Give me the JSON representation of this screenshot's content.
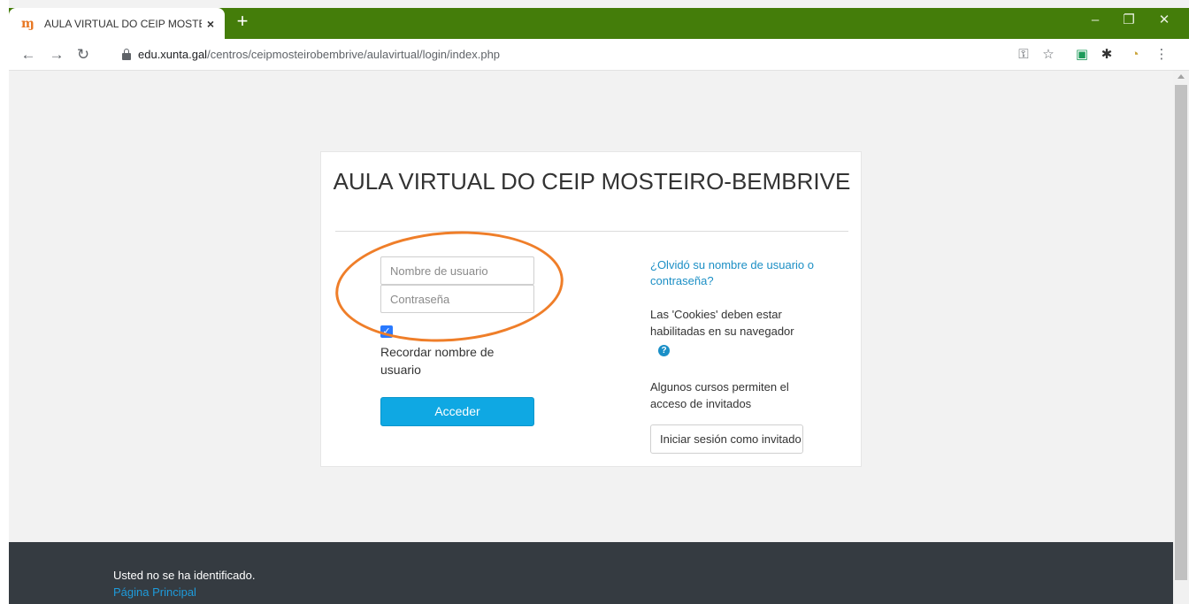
{
  "browser": {
    "tab_title": "AULA VIRTUAL DO CEIP MOSTEIR",
    "tab_close": "×",
    "new_tab": "+",
    "url_host": "edu.xunta.gal",
    "url_path": "/centros/ceipmosteirobembrive/aulavirtual/login/index.php",
    "accent_color": "#447d0a"
  },
  "login": {
    "title": "AULA VIRTUAL DO CEIP MOSTEIRO-BEMBRIVE",
    "username_placeholder": "Nombre de usuario",
    "password_placeholder": "Contraseña",
    "remember_checked": true,
    "remember_label": "Recordar nombre de usuario",
    "submit_label": "Acceder",
    "forgot_link": "¿Olvidó su nombre de usuario o contraseña?",
    "cookies_notice": "Las 'Cookies' deben estar habilitadas en su navegador",
    "guests_notice": "Algunos cursos permiten el acceso de invitados",
    "guest_button": "Iniciar sesión como invitado"
  },
  "footer": {
    "status": "Usted no se ha identificado.",
    "home_link": "Página Principal"
  },
  "colors": {
    "primary_button": "#0fa8e3",
    "link": "#1c8fc5",
    "annotation": "#ef7e29",
    "footer_bg": "#353b41"
  }
}
